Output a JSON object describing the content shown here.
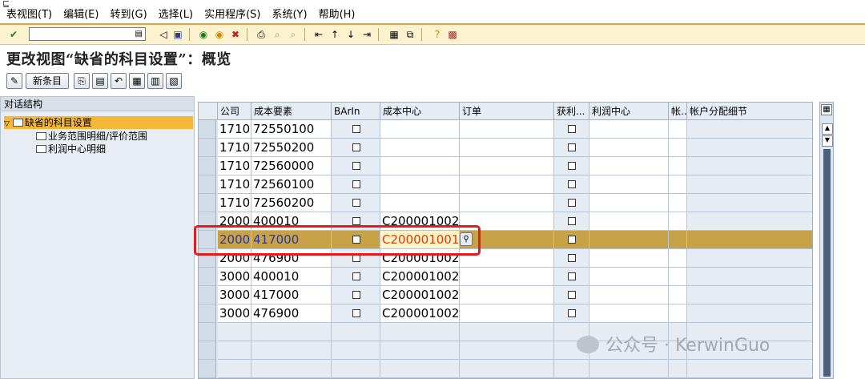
{
  "menu": {
    "items": [
      "表视图(T)",
      "编辑(E)",
      "转到(G)",
      "选择(L)",
      "实用程序(S)",
      "系统(Y)",
      "帮助(H)"
    ]
  },
  "toolbar": {
    "icons": [
      "check-icon",
      "save-icon",
      "back-icon",
      "exit-icon",
      "cancel-icon",
      "print-icon",
      "find-icon",
      "find-next-icon",
      "first-page-icon",
      "prev-page-icon",
      "next-page-icon",
      "last-page-icon",
      "new-session-icon",
      "shortcut-icon",
      "help-icon",
      "layout-icon"
    ]
  },
  "title": "更改视图“缺省的科目设置”：概览",
  "app_toolbar": {
    "new_entries": "新条目"
  },
  "tree": {
    "header": "对话结构",
    "nodes": [
      {
        "label": "缺省的科目设置",
        "selected": true
      },
      {
        "label": "业务范围明细/评价范围"
      },
      {
        "label": "利润中心明细"
      }
    ]
  },
  "grid": {
    "columns": [
      "公司",
      "成本要素",
      "BArIn",
      "成本中心",
      "订单",
      "获利...",
      "利润中心",
      "帐...",
      "帐户分配细节"
    ],
    "rows": [
      {
        "company": "1710",
        "cost_element": "72550100",
        "cost_center": ""
      },
      {
        "company": "1710",
        "cost_element": "72550200",
        "cost_center": ""
      },
      {
        "company": "1710",
        "cost_element": "72560000",
        "cost_center": ""
      },
      {
        "company": "1710",
        "cost_element": "72560100",
        "cost_center": ""
      },
      {
        "company": "1710",
        "cost_element": "72560200",
        "cost_center": ""
      },
      {
        "company": "2000",
        "cost_element": "400010",
        "cost_center": "C200001002"
      },
      {
        "company": "2000",
        "cost_element": "417000",
        "cost_center": "C200001001",
        "highlighted": true
      },
      {
        "company": "2000",
        "cost_element": "476900",
        "cost_center": "C200001002"
      },
      {
        "company": "3000",
        "cost_element": "400010",
        "cost_center": "C200001002"
      },
      {
        "company": "3000",
        "cost_element": "417000",
        "cost_center": "C200001002"
      },
      {
        "company": "3000",
        "cost_element": "476900",
        "cost_center": "C200001002"
      }
    ]
  },
  "watermark": "公众号 · KerwinGuo",
  "colors": {
    "highlight_row": "#c7a247",
    "toolbar_bg": "#fbf2cf",
    "red_box": "#e21c1c"
  }
}
